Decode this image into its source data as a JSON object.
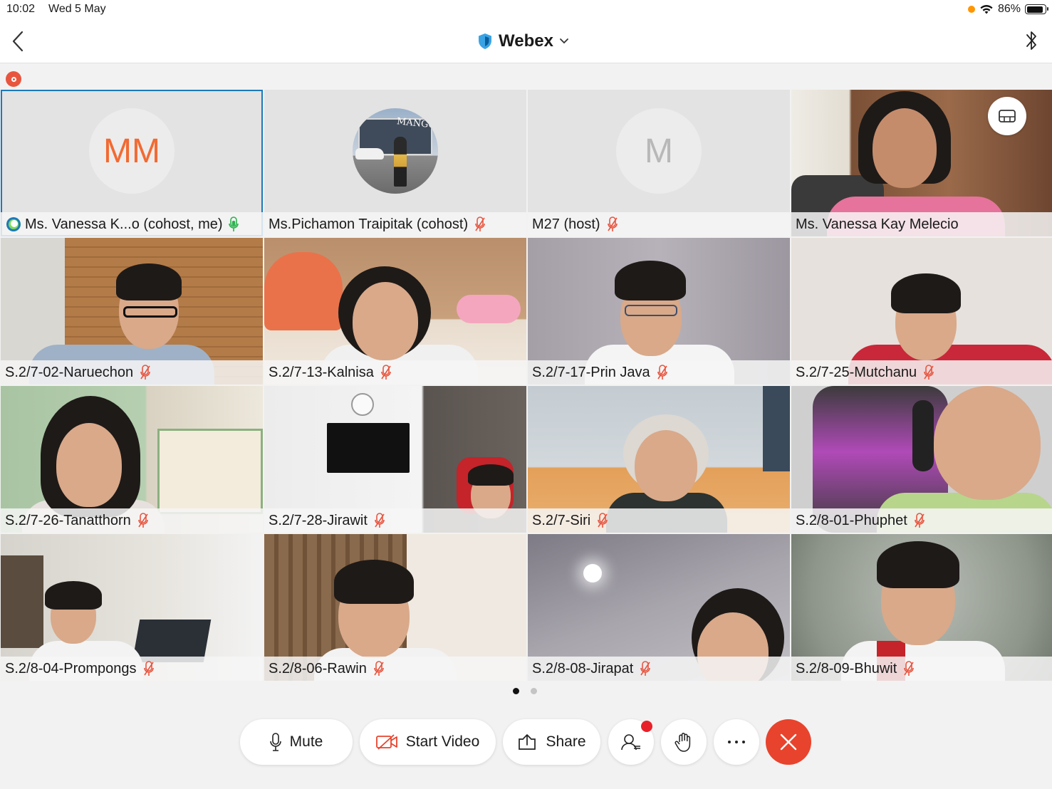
{
  "status_bar": {
    "time": "10:02",
    "date": "Wed 5 May",
    "battery": "86%"
  },
  "header": {
    "title": "Webex"
  },
  "participants": [
    {
      "name": "Ms. Vanessa K...o (cohost, me)",
      "avatar_text": "MM",
      "mic": "active"
    },
    {
      "name": "Ms.Pichamon Traipitak (cohost)",
      "avatar_text": "",
      "mic": "muted"
    },
    {
      "name": "M27 (host)",
      "avatar_text": "M",
      "mic": "muted"
    },
    {
      "name": "Ms. Vanessa Kay Melecio",
      "mic": "none"
    },
    {
      "name": "S.2/7-02-Naruechon",
      "mic": "muted"
    },
    {
      "name": "S.2/7-13-Kalnisa",
      "mic": "muted"
    },
    {
      "name": "S.2/7-17-Prin Java",
      "mic": "muted"
    },
    {
      "name": "S.2/7-25-Mutchanu",
      "mic": "muted"
    },
    {
      "name": "S.2/7-26-Tanatthorn",
      "mic": "muted"
    },
    {
      "name": "S.2/7-28-Jirawit",
      "mic": "muted"
    },
    {
      "name": "S.2/7-Siri",
      "mic": "muted"
    },
    {
      "name": "S.2/8-01-Phuphet",
      "mic": "muted"
    },
    {
      "name": "S.2/8-04-Prompongs",
      "mic": "muted"
    },
    {
      "name": "S.2/8-06-Rawin",
      "mic": "muted"
    },
    {
      "name": "S.2/8-08-Jirapat",
      "mic": "muted"
    },
    {
      "name": "S.2/8-09-Bhuwit",
      "mic": "muted"
    }
  ],
  "toolbar": {
    "mute": "Mute",
    "start_video": "Start Video",
    "share": "Share"
  },
  "colors": {
    "accent": "#1c7ab9",
    "end_call": "#e8432c",
    "muted_icon": "#e8553f",
    "active_mic": "#2bb24c",
    "avatar_initials": "#f26a32"
  }
}
